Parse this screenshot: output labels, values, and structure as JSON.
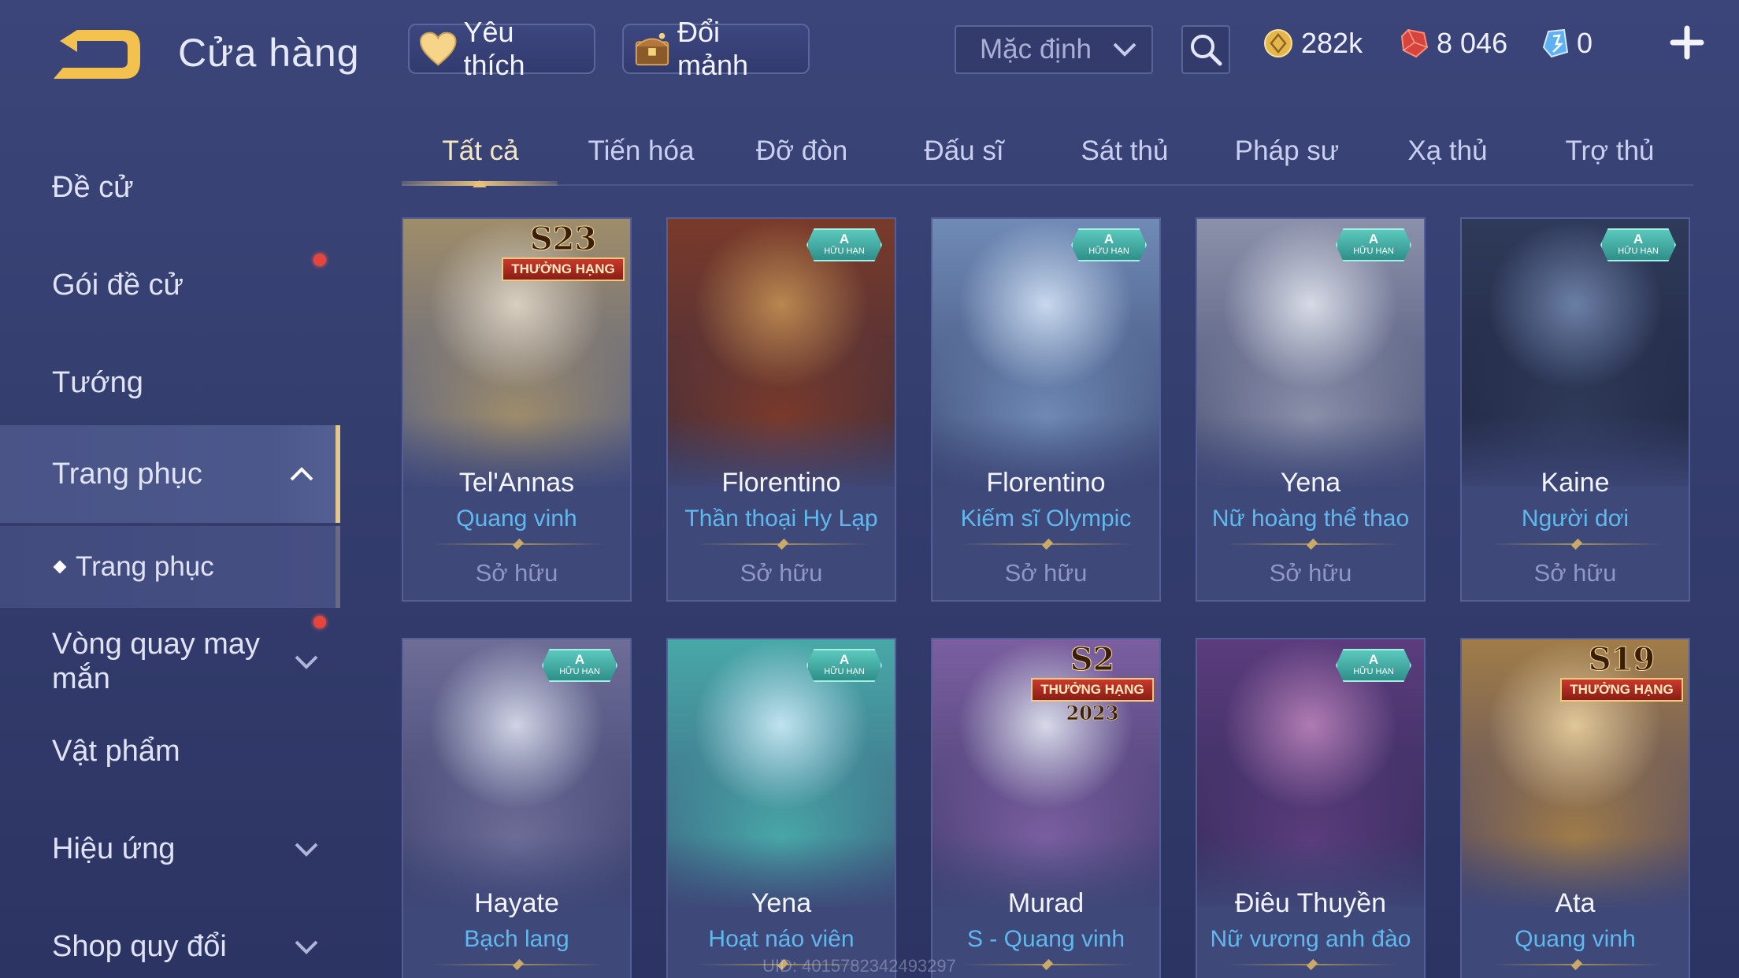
{
  "header": {
    "title": "Cửa hàng",
    "favorites_label": "Yêu thích",
    "shard_label": "Đổi mảnh",
    "sort_value": "Mặc định",
    "gold": "282k",
    "vouchers": "8 046",
    "gems": "0"
  },
  "sidebar": {
    "items": [
      {
        "label": "Đề cử"
      },
      {
        "label": "Gói đề cử"
      },
      {
        "label": "Tướng"
      },
      {
        "label": "Trang phục"
      },
      {
        "label": "Trang phục"
      },
      {
        "label": "Vòng quay may mắn"
      },
      {
        "label": "Vật phẩm"
      },
      {
        "label": "Hiệu ứng"
      },
      {
        "label": "Shop quy đổi"
      }
    ]
  },
  "tabs": [
    "Tất cả",
    "Tiến hóa",
    "Đỡ đòn",
    "Đấu sĩ",
    "Sát thủ",
    "Pháp sư",
    "Xạ thủ",
    "Trợ thủ"
  ],
  "owned_label": "Sở hữu",
  "badges": {
    "a_letter": "A",
    "a_text": "HỮU HẠN",
    "rank_text": "THƯỞNG HẠNG"
  },
  "cards": [
    {
      "hero": "Tel'Annas",
      "skin": "Quang vinh",
      "badge": "S23",
      "palette": [
        "#d8cfc0",
        "#9f8d6a",
        "#4f5b86"
      ]
    },
    {
      "hero": "Florentino",
      "skin": "Thần thoại Hy Lạp",
      "badge": "A",
      "palette": [
        "#b9874f",
        "#7a3a2a",
        "#3b2d3f"
      ]
    },
    {
      "hero": "Florentino",
      "skin": "Kiếm sĩ Olympic",
      "badge": "A",
      "palette": [
        "#c7d8ee",
        "#6f8bb6",
        "#38456f"
      ]
    },
    {
      "hero": "Yena",
      "skin": "Nữ hoàng thể thao",
      "badge": "A",
      "palette": [
        "#d7dbe6",
        "#8b91aa",
        "#41496f"
      ]
    },
    {
      "hero": "Kaine",
      "skin": "Người dơi",
      "badge": "A",
      "palette": [
        "#6b7fa5",
        "#2f3a5a",
        "#1e2540"
      ]
    },
    {
      "hero": "Hayate",
      "skin": "Bạch lang",
      "badge": "A",
      "palette": [
        "#cfd3e4",
        "#6e6d98",
        "#363c66"
      ]
    },
    {
      "hero": "Yena",
      "skin": "Hoạt náo viên",
      "badge": "A",
      "palette": [
        "#bfe3ef",
        "#48a8a8",
        "#3b5a7c"
      ]
    },
    {
      "hero": "Murad",
      "skin": "S - Quang vinh",
      "badge": "S2",
      "year": "2023",
      "palette": [
        "#d6d9e8",
        "#7b5fa0",
        "#3a3768"
      ]
    },
    {
      "hero": "Điêu Thuyền",
      "skin": "Nữ vương anh đào",
      "badge": "A",
      "palette": [
        "#b07bb3",
        "#5b3c7d",
        "#2e2a55"
      ]
    },
    {
      "hero": "Ata",
      "skin": "Quang vinh",
      "badge": "S19",
      "palette": [
        "#e0c797",
        "#a07c48",
        "#4a4367"
      ]
    }
  ],
  "uid_text": "UID: 4015782342493297",
  "colors": {
    "accent_gold": "#e8c27c",
    "skin_blue": "#5fb8ee",
    "notify_red": "#e5453d"
  }
}
